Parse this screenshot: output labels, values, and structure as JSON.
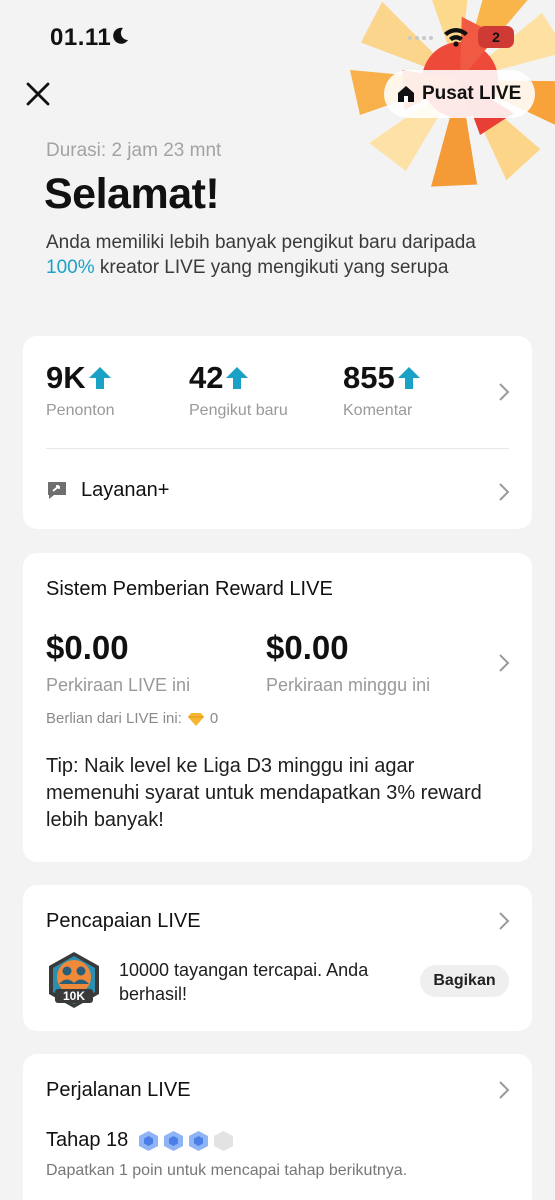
{
  "status_bar": {
    "time": "01.11",
    "battery": "2"
  },
  "header": {
    "live_center_label": "Pusat LIVE"
  },
  "summary": {
    "duration": "Durasi: 2 jam 23 mnt",
    "title": "Selamat!",
    "desc_part1": "Anda memiliki lebih banyak pengikut baru daripada ",
    "desc_highlight": "100%",
    "desc_part2": " kreator LIVE yang mengikuti yang serupa"
  },
  "stats": {
    "items": [
      {
        "value": "9K",
        "label": "Penonton"
      },
      {
        "value": "42",
        "label": "Pengikut baru"
      },
      {
        "value": "855",
        "label": "Komentar"
      }
    ],
    "service_label": "Layanan+"
  },
  "rewards": {
    "title": "Sistem Pemberian Reward LIVE",
    "live_value": "$0.00",
    "live_label": "Perkiraan LIVE ini",
    "week_value": "$0.00",
    "week_label": "Perkiraan minggu ini",
    "diamonds_label": "Berlian dari LIVE ini:",
    "diamonds_value": "0",
    "tip": "Tip: Naik level ke Liga D3 minggu ini agar memenuhi syarat untuk mendapatkan 3% reward lebih banyak!"
  },
  "achievements": {
    "title": "Pencapaian LIVE",
    "badge_label": "10K",
    "text": "10000 tayangan tercapai. Anda berhasil!",
    "share_label": "Bagikan"
  },
  "journey": {
    "title": "Perjalanan LIVE",
    "stage": "Tahap 18",
    "levels_filled": 3,
    "levels_total": 4,
    "hint": "Dapatkan 1 poin untuk mencapai tahap berikutnya."
  },
  "colors": {
    "accent": "#1ba1c6",
    "battery": "#cf3b34",
    "burst": "#f5a623"
  }
}
